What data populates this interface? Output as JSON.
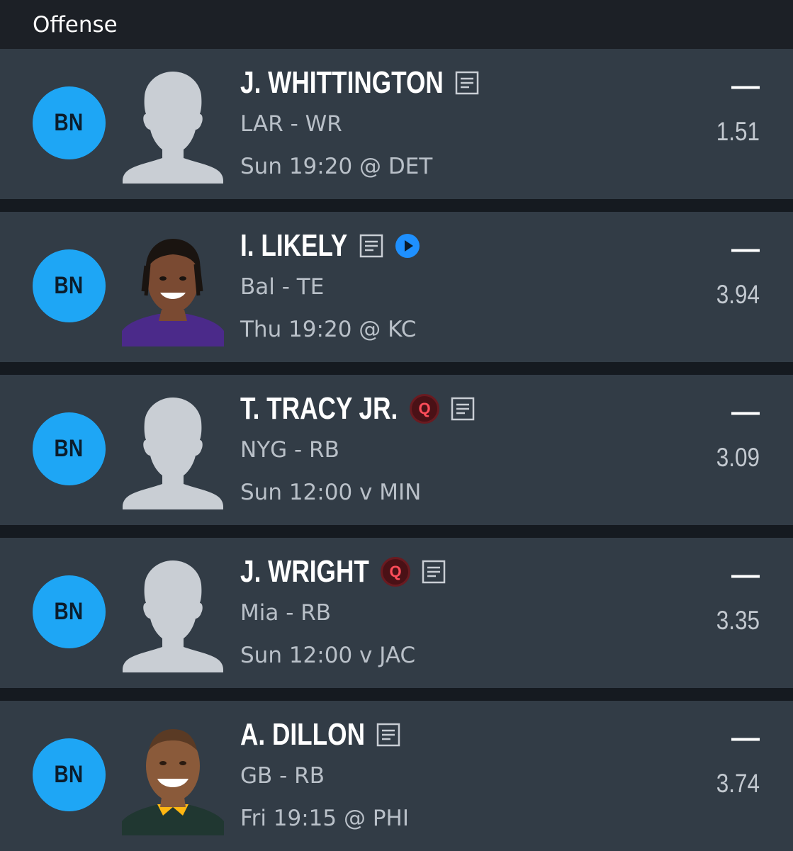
{
  "section": {
    "title": "Offense"
  },
  "players": [
    {
      "slot": "BN",
      "name": "J. WHITTINGTON",
      "injury": "",
      "has_news": true,
      "has_video": false,
      "photo": "silhouette-icon",
      "team_pos": "LAR - WR",
      "game": "Sun 19:20 @ DET",
      "dash": "—",
      "points": "1.51"
    },
    {
      "slot": "BN",
      "name": "I. LIKELY",
      "injury": "",
      "has_news": true,
      "has_video": true,
      "photo": "player-photo",
      "team_pos": "Bal - TE",
      "game": "Thu 19:20 @ KC",
      "dash": "—",
      "points": "3.94"
    },
    {
      "slot": "BN",
      "name": "T. TRACY JR.",
      "injury": "Q",
      "has_news": true,
      "has_video": false,
      "photo": "silhouette-icon",
      "team_pos": "NYG - RB",
      "game": "Sun 12:00 v MIN",
      "dash": "—",
      "points": "3.09"
    },
    {
      "slot": "BN",
      "name": "J. WRIGHT",
      "injury": "Q",
      "has_news": true,
      "has_video": false,
      "photo": "silhouette-icon",
      "team_pos": "Mia - RB",
      "game": "Sun 12:00 v JAC",
      "dash": "—",
      "points": "3.35"
    },
    {
      "slot": "BN",
      "name": "A. DILLON",
      "injury": "",
      "has_news": true,
      "has_video": false,
      "photo": "player-photo",
      "team_pos": "GB - RB",
      "game": "Fri 19:15 @ PHI",
      "dash": "—",
      "points": "3.74"
    }
  ],
  "colors": {
    "slot_badge": "#1ea6f5",
    "row_bg": "#323c46",
    "header_bg": "#1c2026",
    "injury_q": "#ff4d5a",
    "video_icon": "#1e90ff"
  }
}
